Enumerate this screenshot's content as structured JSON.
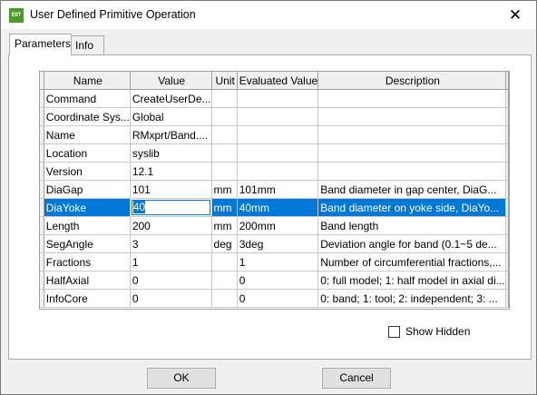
{
  "window": {
    "title": "User Defined Primitive Operation",
    "app_icon_text": "EDT",
    "close_glyph": "✕"
  },
  "tabs": [
    {
      "label": "Parameters",
      "active": true
    },
    {
      "label": "Info",
      "active": false
    }
  ],
  "grid": {
    "headers": [
      "Name",
      "Value",
      "Unit",
      "Evaluated Value",
      "Description"
    ],
    "rows": [
      {
        "name": "Command",
        "value": "CreateUserDe...",
        "unit": "",
        "evaluated": "",
        "description": ""
      },
      {
        "name": "Coordinate Sys...",
        "value": "Global",
        "unit": "",
        "evaluated": "",
        "description": ""
      },
      {
        "name": "Name",
        "value": "RMxprt/Band....",
        "unit": "",
        "evaluated": "",
        "description": ""
      },
      {
        "name": "Location",
        "value": "syslib",
        "unit": "",
        "evaluated": "",
        "description": ""
      },
      {
        "name": "Version",
        "value": "12.1",
        "unit": "",
        "evaluated": "",
        "description": ""
      },
      {
        "name": "DiaGap",
        "value": "101",
        "unit": "mm",
        "evaluated": "101mm",
        "description": "Band diameter in gap center, DiaG..."
      },
      {
        "name": "DiaYoke",
        "value": "40",
        "unit": "mm",
        "evaluated": "40mm",
        "description": "Band diameter on yoke side, DiaYo...",
        "selected": true
      },
      {
        "name": "Length",
        "value": "200",
        "unit": "mm",
        "evaluated": "200mm",
        "description": "Band length"
      },
      {
        "name": "SegAngle",
        "value": "3",
        "unit": "deg",
        "evaluated": "3deg",
        "description": "Deviation angle for band (0.1~5 de..."
      },
      {
        "name": "Fractions",
        "value": "1",
        "unit": "",
        "evaluated": "1",
        "description": "Number of circumferential fractions,..."
      },
      {
        "name": "HalfAxial",
        "value": "0",
        "unit": "",
        "evaluated": "0",
        "description": "0: full model; 1: half model in axial di..."
      },
      {
        "name": "InfoCore",
        "value": "0",
        "unit": "",
        "evaluated": "0",
        "description": "0: band; 1: tool; 2: independent; 3: ..."
      }
    ]
  },
  "show_hidden": {
    "label": "Show Hidden",
    "checked": false
  },
  "buttons": {
    "ok": "OK",
    "cancel": "Cancel"
  }
}
